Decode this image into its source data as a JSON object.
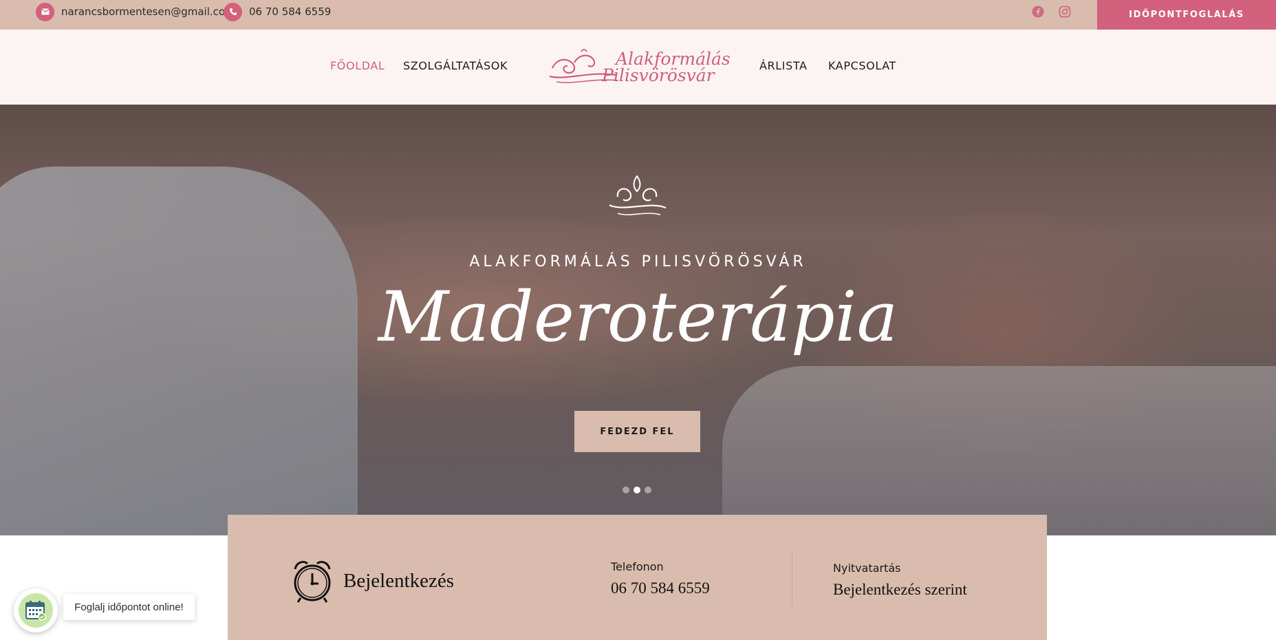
{
  "topbar": {
    "email": "narancsbormentesen@gmail.com",
    "phone": "06 70 584 6559",
    "social_icons": [
      "facebook-icon",
      "instagram-icon"
    ],
    "booking_button": "IDŐPONTFOGLALÁS"
  },
  "nav": {
    "items": [
      {
        "label": "FŐOLDAL",
        "active": true
      },
      {
        "label": "SZOLGÁLTATÁSOK",
        "active": false
      },
      {
        "label": "ÁRLISTA",
        "active": false
      },
      {
        "label": "KAPCSOLAT",
        "active": false
      }
    ],
    "logo": {
      "line1": "Alakformálás",
      "line2": "Pilisvörösvár"
    }
  },
  "hero": {
    "kicker": "ALAKFORMÁLÁS PILISVÖRÖSVÁR",
    "title": "Maderoterápia",
    "button": "FEDEZD FEL",
    "slides": 3,
    "active_slide": 2
  },
  "info": {
    "login_label": "Bejelentkezés",
    "phone_label": "Telefonon",
    "phone": "06 70 584 6559",
    "hours_label": "Nyitvatartás",
    "hours": "Bejelentkezés szerint"
  },
  "widget": {
    "label": "Foglalj időpontot online!",
    "icon": "calendar-icon"
  },
  "colors": {
    "topbar_bg": "#d9bcad",
    "accent_pink": "#d3607c",
    "header_bg": "#fcf4f3",
    "info_bg": "#d9bcad"
  }
}
